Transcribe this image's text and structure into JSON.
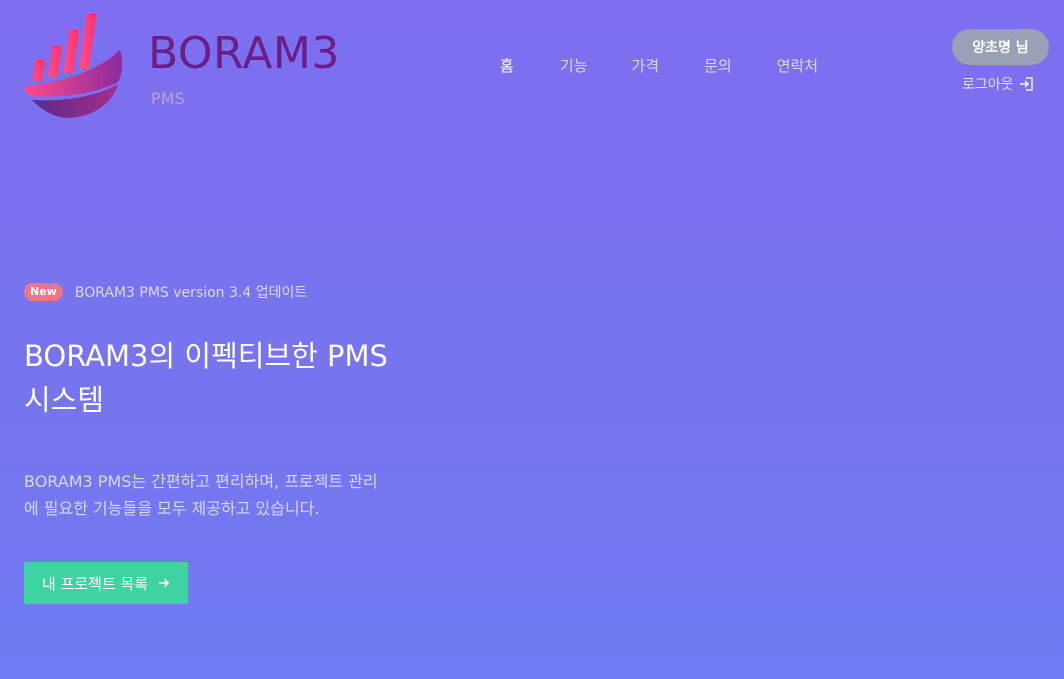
{
  "brand": {
    "name": "BORAM3",
    "sub": "PMS"
  },
  "nav": {
    "items": [
      "홈",
      "기능",
      "가격",
      "문의",
      "연락처"
    ],
    "active_index": 0
  },
  "user": {
    "greeting": "양초명 님",
    "logout_label": "로그아웃"
  },
  "hero": {
    "badge": "New",
    "announcement": "BORAM3 PMS version 3.4 업데이트",
    "title_line1": "BORAM3의 이펙티브한 PMS",
    "title_line2": "시스템",
    "description_line1": "BORAM3 PMS는 간편하고 편리하며, 프로젝트 관리",
    "description_line2": "에 필요한 기능들을 모두 제공하고 있습니다.",
    "cta_label": "내 프로젝트 목록"
  },
  "colors": {
    "background_top": "#7e6ff0",
    "background_bottom": "#6f7cf3",
    "brand_text": "#6a1e86",
    "cta": "#40d3a2",
    "badge_new": "#f0758a",
    "user_badge": "#9aa0b5"
  },
  "icons": {
    "cta": "arrow-right-icon",
    "logout": "logout-icon"
  }
}
